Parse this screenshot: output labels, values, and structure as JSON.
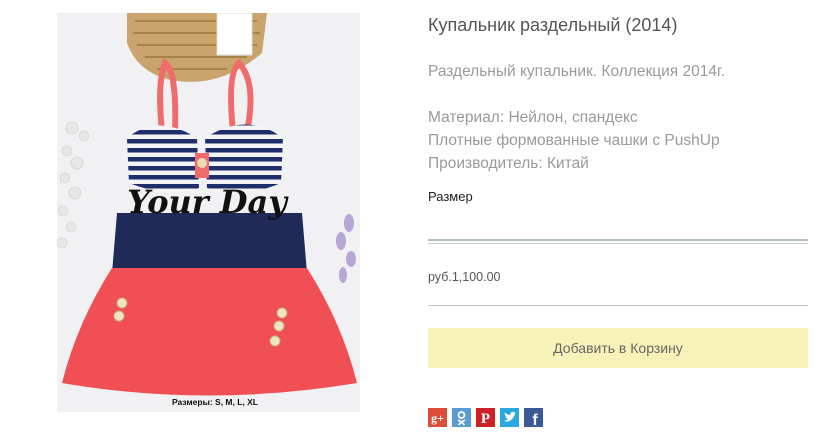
{
  "product": {
    "title": "Купальник раздельный (2014)",
    "description": [
      "Раздельный купальник. Коллекция 2014г.",
      "",
      "Материал: Нейлон, спандекс",
      "Плотные формованные чашки с PushUp",
      "Производитель: Китай"
    ],
    "size_label": "Размер",
    "size_value": "",
    "price": "руб.1,100.00",
    "add_to_cart_label": "Добавить в Корзину"
  },
  "photo": {
    "watermark": "Your Day",
    "caption": "Размеры: S, M, L, XL"
  },
  "social": [
    {
      "name": "google-plus",
      "color": "#dd4b39",
      "glyph": "g+"
    },
    {
      "name": "odnoklassniki",
      "color": "#5b9bd5",
      "glyph": "ok"
    },
    {
      "name": "pinterest",
      "color": "#cb2027",
      "glyph": "P"
    },
    {
      "name": "twitter",
      "color": "#2aa9e0",
      "glyph": "t"
    },
    {
      "name": "facebook",
      "color": "#3b5998",
      "glyph": "f"
    }
  ],
  "colors": {
    "cart_button_bg": "#f7f2b8",
    "select_underline": "#b3c0b8"
  }
}
